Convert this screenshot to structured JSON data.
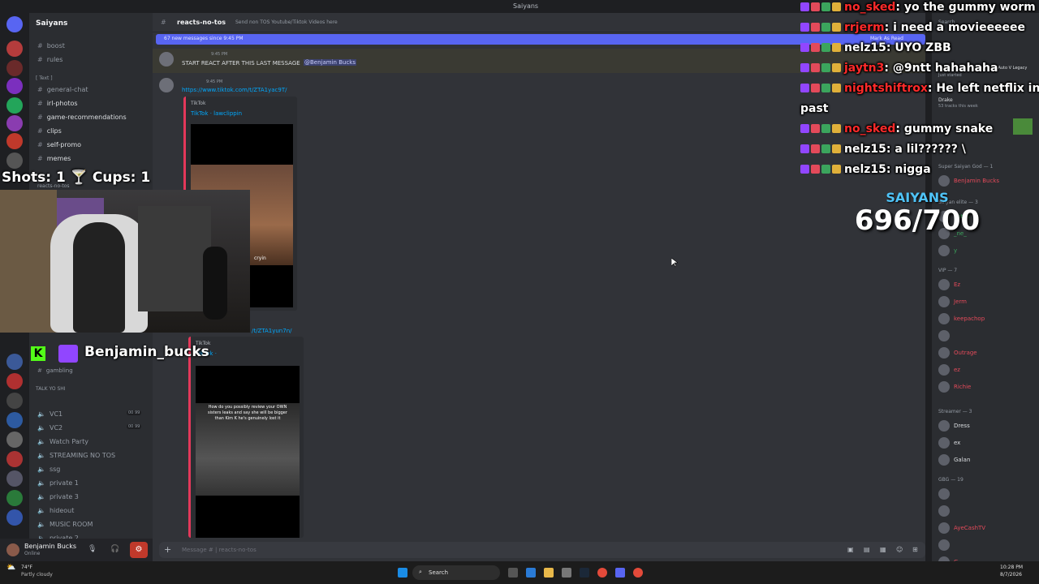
{
  "titlebar": {
    "title": "Saiyans"
  },
  "server": {
    "name": "Saiyans"
  },
  "channels": {
    "top": [
      "boost",
      "rules"
    ],
    "category_text": "[ Text ]",
    "text": [
      "general-chat",
      "irl-photos",
      "game-recommendations",
      "clips",
      "self-promo",
      "memes"
    ],
    "partial": [
      "reacts-no-tos",
      "gambling"
    ],
    "category_voice": "TALK YO SHI",
    "voice": [
      {
        "name": "VC1",
        "count": "00 99"
      },
      {
        "name": "VC2",
        "count": "00 99"
      },
      {
        "name": "Watch Party",
        "count": ""
      },
      {
        "name": "STREAMING NO TOS",
        "count": ""
      },
      {
        "name": "ssg",
        "count": ""
      },
      {
        "name": "private 1",
        "count": ""
      },
      {
        "name": "private 3",
        "count": ""
      },
      {
        "name": "hideout",
        "count": ""
      },
      {
        "name": "MUSIC ROOM",
        "count": ""
      },
      {
        "name": "private 2",
        "count": ""
      }
    ]
  },
  "user": {
    "name": "Benjamin Bucks",
    "status": "Online"
  },
  "chat": {
    "channel": "reacts-no-tos",
    "topic": "Send non TOS Youtube/Tiktok Videos here",
    "new_messages": "67 new messages since 9:45 PM",
    "mark_read": "Mark As Read",
    "pinned_time": "9:45 PM",
    "pinned_text": "START REACT AFTER THIS LAST MESSAGE",
    "pinned_mention": "@Benjamin Bucks",
    "msg2_time": "9:45 PM",
    "link1": "https://www.tiktok.com/t/ZTA1yac9T/",
    "embed1_label": "TikTok",
    "embed1_title": "TikTok · lawclippin",
    "embed1_caption": "cryin",
    "link2": "/t/ZTA1yun7n/",
    "embed2_label": "TikTok",
    "embed2_title": "TikTok ·",
    "embed2_caption": "How do you possibly review your OWN sisters leaks and say she will be bigger than Kim K  he's genuinely lost it",
    "composer_placeholder": "Message #  | reacts-no-tos"
  },
  "members": {
    "search": "Search",
    "playing": "Grand Theft Auto V Legacy",
    "playing_sub": "Just started",
    "listening": "Drake",
    "listening_sub": "53 tracks this week",
    "groups": [
      {
        "title": "Super Saiyan God — 1",
        "names": [
          "Benjamin Bucks"
        ]
      },
      {
        "title": "Saiyan elite — 3",
        "names": [
          "critch",
          "_ne_",
          "y"
        ]
      },
      {
        "title": "VIP — 7",
        "names": [
          "Ez",
          "Jerm",
          "keepachop",
          "",
          "Outrage",
          "ez",
          "Richie"
        ]
      },
      {
        "title": "Streamer — 3",
        "names": [
          "Dress",
          "ex",
          "Galan"
        ]
      },
      {
        "title": "GBG — 19",
        "names": [
          "",
          "",
          "AyeCashTV",
          "",
          "G"
        ]
      }
    ]
  },
  "overlay": {
    "counters": "Shots: 1  🍸  Cups: 1",
    "twitch_user": "Benjamin_bucks",
    "goal_name": "SAIYANS",
    "goal_count": "696/700",
    "chat": [
      {
        "user": "no_sked",
        "color": "#ff2a2a",
        "text": "yo the gummy worm"
      },
      {
        "user": "rrjerm",
        "color": "#ff2a2a",
        "text": "i need a movieeeeee"
      },
      {
        "user": "nelz15",
        "color": "#ffffff",
        "text": "UYO ZBB"
      },
      {
        "user": "jaytn3",
        "color": "#ff2a2a",
        "text": "@9ntt hahahaha"
      },
      {
        "user": "nightshiftrox",
        "color": "#ff2a2a",
        "text": "He left netflix in the"
      },
      {
        "user": "",
        "color": "#ffffff",
        "text": "past"
      },
      {
        "user": "no_sked",
        "color": "#ff2a2a",
        "text": "gummy snake"
      },
      {
        "user": "nelz15",
        "color": "#ffffff",
        "text": "a lil?????? \\"
      },
      {
        "user": "nelz15",
        "color": "#ffffff",
        "text": "nigga"
      }
    ]
  },
  "taskbar": {
    "weather_temp": "74°F",
    "weather_desc": "Partly cloudy",
    "search": "Search",
    "time": "10:28 PM",
    "date": "8/7/2026"
  }
}
